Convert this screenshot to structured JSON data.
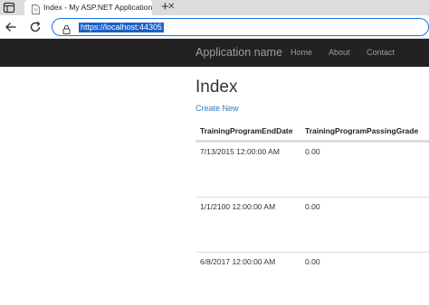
{
  "browser": {
    "tab_title": "Index - My ASP.NET Application",
    "tab_close": "✕",
    "new_tab": "+",
    "url": "https://localhost:44305"
  },
  "app": {
    "brand": "Application name",
    "menu": [
      {
        "label": "Home"
      },
      {
        "label": "About"
      },
      {
        "label": "Contact"
      }
    ]
  },
  "page": {
    "title": "Index",
    "create_link": "Create New"
  },
  "table": {
    "headers": [
      "TrainingProgramEndDate",
      "TrainingProgramPassingGrade"
    ],
    "rows": [
      [
        "7/13/2015 12:00:00 AM",
        "0.00"
      ],
      [
        "1/1/2100 12:00:00 AM",
        "0.00"
      ],
      [
        "6/8/2017 12:00:00 AM",
        "0.00"
      ]
    ]
  },
  "colors": {
    "navbar_bg": "#222222",
    "nav_text": "#9d9d9d",
    "link": "#337ab7",
    "url_highlight": "#1b5fc9"
  },
  "icons": [
    "tab-actions-icon",
    "page-favicon-icon",
    "back-arrow-icon",
    "refresh-icon",
    "lock-icon"
  ]
}
